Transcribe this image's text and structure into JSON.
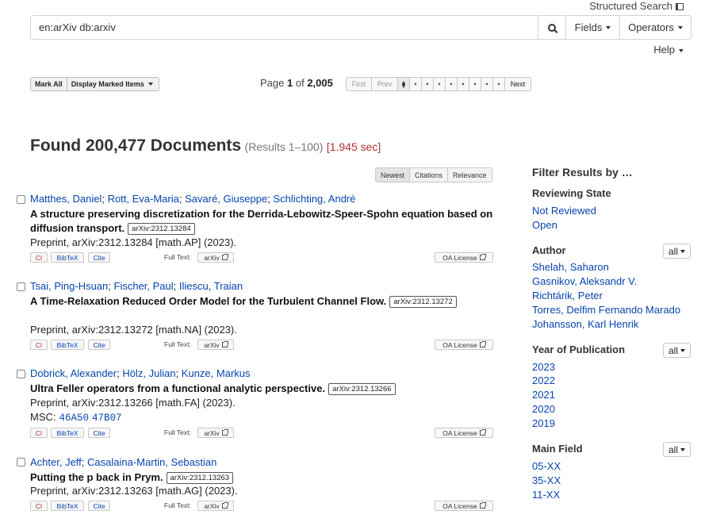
{
  "header": {
    "structured_search": "Structured Search",
    "query": "en:arXiv db:arxiv",
    "fields": "Fields",
    "operators": "Operators",
    "help": "Help"
  },
  "toolbar": {
    "mark_all": "Mark All",
    "display_marked": "Display Marked Items",
    "page_label": "Page",
    "page_current": "1",
    "page_of": "of",
    "page_total": "2,005",
    "first": "First",
    "prev": "Prev",
    "current_marker": "⧫",
    "dot": "•",
    "next": "Next"
  },
  "found": {
    "heading": "Found 200,477 Documents",
    "range": "(Results 1–100)",
    "time": "[1.945 sec]"
  },
  "sort": [
    "Newest",
    "Citations",
    "Relevance"
  ],
  "link_labels": {
    "ci": "CI",
    "bibtex": "BibTeX",
    "cite": "Cite",
    "full_text": "Full Text:",
    "arxiv": "arXiv",
    "oa": "OA License"
  },
  "results": [
    {
      "authors": [
        "Matthes, Daniel",
        "Rott, Eva-Maria",
        "Savaré, Giuseppe",
        "Schlichting, André"
      ],
      "title": "A structure preserving discretization for the Derrida-Lebowitz-Speer-Spohn equation based on diffusion transport.",
      "arxiv": "arXiv:2312.13284",
      "pubinfo": "Preprint, arXiv:2312.13284 [math.AP] (2023).",
      "msc": []
    },
    {
      "authors": [
        "Tsai, Ping-Hsuan",
        "Fischer, Paul",
        "Iliescu, Traian"
      ],
      "title": "A Time-Relaxation Reduced Order Model for the Turbulent Channel Flow.",
      "arxiv": "arXiv:2312.13272",
      "pubinfo": "Preprint, arXiv:2312.13272 [math.NA] (2023).",
      "msc": []
    },
    {
      "authors": [
        "Dobrick, Alexander",
        "Hölz, Julian",
        "Kunze, Markus"
      ],
      "title": "Ultra Feller operators from a functional analytic perspective.",
      "arxiv": "arXiv:2312.13266",
      "pubinfo": "Preprint, arXiv:2312.13266 [math.FA] (2023).",
      "msc_label": "MSC:",
      "msc": [
        "46A50",
        "47B07"
      ]
    },
    {
      "authors": [
        "Achter, Jeff",
        "Casalaina-Martin, Sebastian"
      ],
      "title": "Putting the p back in Prym.",
      "arxiv": "arXiv:2312.13263",
      "pubinfo": "Preprint, arXiv:2312.13263 [math.AG] (2023).",
      "msc": []
    }
  ],
  "sidebar": {
    "title": "Filter Results by …",
    "reviewing_state": {
      "label": "Reviewing State",
      "items": [
        "Not Reviewed",
        "Open"
      ]
    },
    "author": {
      "label": "Author",
      "all": "all",
      "items": [
        "Shelah, Saharon",
        "Gasnikov, Aleksandr V.",
        "Richtárik, Peter",
        "Torres, Delfim Fernando Marado",
        "Johansson, Karl Henrik"
      ]
    },
    "year": {
      "label": "Year of Publication",
      "all": "all",
      "items": [
        "2023",
        "2022",
        "2021",
        "2020",
        "2019"
      ]
    },
    "main_field": {
      "label": "Main Field",
      "all": "all",
      "items": [
        "05-XX",
        "35-XX",
        "11-XX"
      ]
    }
  }
}
